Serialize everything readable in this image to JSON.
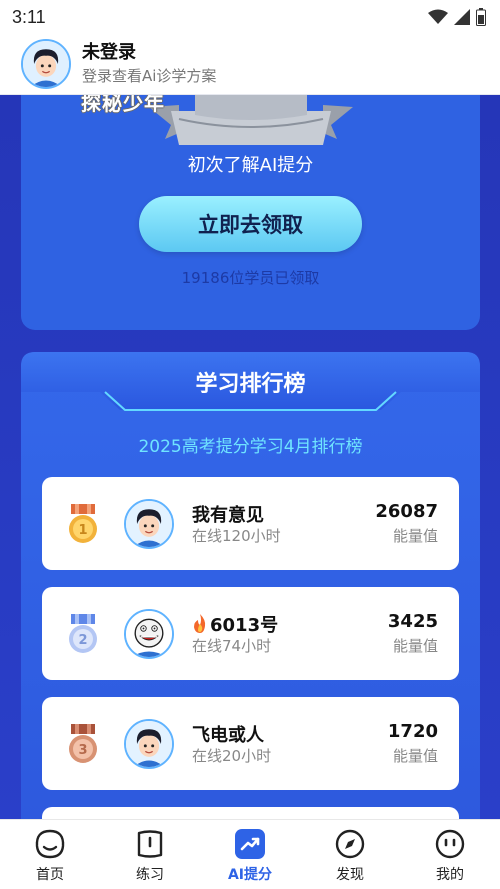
{
  "status_bar": {
    "time": "3:11"
  },
  "header": {
    "title": "未登录",
    "subtitle": "登录查看Ai诊学方案"
  },
  "promo_card": {
    "ribbon_text": "探秘少年",
    "description": "初次了解AI提分",
    "button_label": "立即去领取",
    "claim_count": "19186位学员已领取"
  },
  "ranking": {
    "title": "学习排行榜",
    "subtitle": "2025高考提分学习4月排行榜",
    "items": [
      {
        "rank": 1,
        "medal_color": "#f2b23a",
        "name": "我有意见",
        "online": "在线120小时",
        "score": "26087",
        "unit": "能量值",
        "avatar": "boy-avatar"
      },
      {
        "rank": 2,
        "medal_color": "#8fb0f5",
        "name": "6013号",
        "prefix_icon": "fire-icon",
        "online": "在线74小时",
        "score": "3425",
        "unit": "能量值",
        "avatar": "meme-face-avatar"
      },
      {
        "rank": 3,
        "medal_color": "#d89273",
        "name": "飞电或人",
        "online": "在线20小时",
        "score": "1720",
        "unit": "能量值",
        "avatar": "boy-avatar"
      }
    ]
  },
  "bottom_nav": {
    "items": [
      {
        "label": "首页",
        "icon": "home-face-icon",
        "active": false
      },
      {
        "label": "练习",
        "icon": "practice-icon",
        "active": false
      },
      {
        "label": "AI提分",
        "icon": "trend-up-icon",
        "active": true
      },
      {
        "label": "发现",
        "icon": "compass-icon",
        "active": false
      },
      {
        "label": "我的",
        "icon": "profile-face-icon",
        "active": false
      }
    ]
  },
  "colors": {
    "accent": "#2e63e6",
    "panel_blue": "#2f62e2",
    "page_blue": "#2a40c8",
    "subtitle_cyan": "#6fe4ff"
  }
}
